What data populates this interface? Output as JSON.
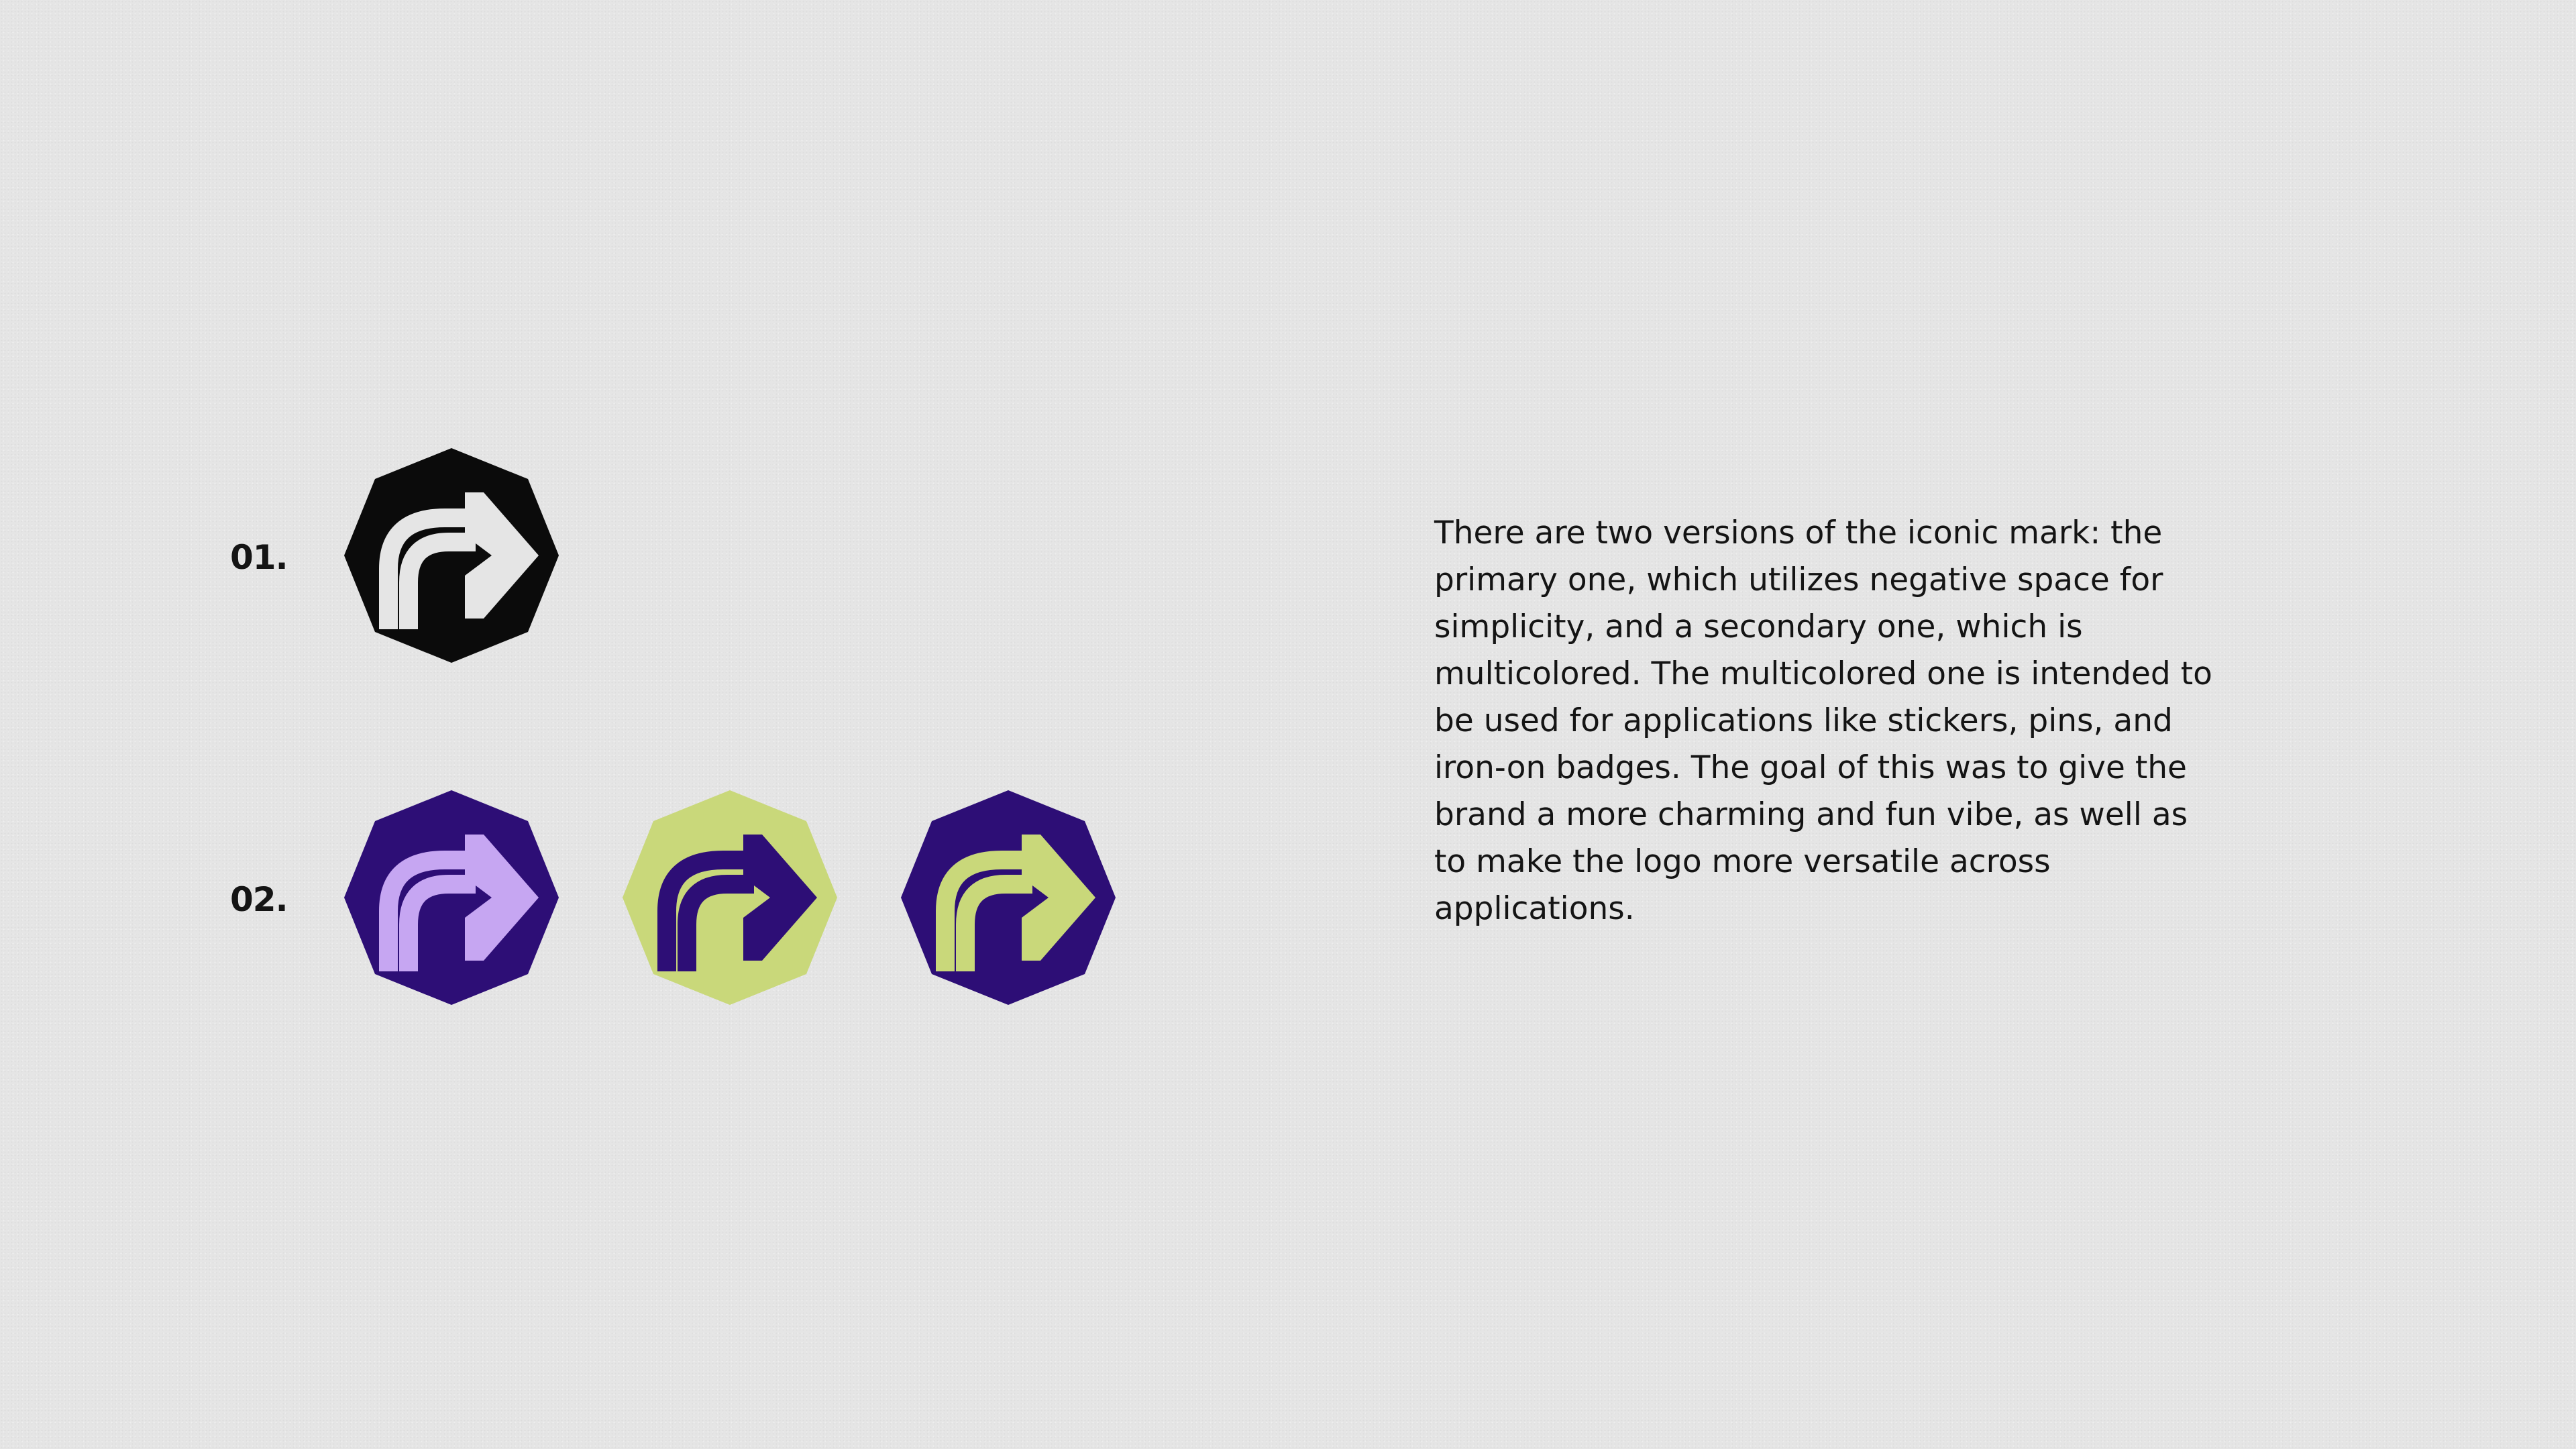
{
  "labels": {
    "primary": "01.",
    "secondary": "02."
  },
  "description": "There are two versions of the iconic mark: the primary one, which utilizes negative space for simplicity, and a secondary one, which is multicolored. The multicolored one is intended to be used for applications like stickers, pins, and iron-on badges. The goal of this was to give the brand a more charming and fun vibe, as well as to make the logo more versatile across applications.",
  "marks": [
    {
      "name": "primary-mark-black",
      "star_color": "#0b0b0b",
      "arrow_color": "#e5e5e5"
    },
    {
      "name": "secondary-mark-purple-lavender",
      "star_color": "#2d0e76",
      "arrow_color": "#c6a6f2"
    },
    {
      "name": "secondary-mark-lime-purple",
      "star_color": "#c9d87a",
      "arrow_color": "#2d0e76"
    },
    {
      "name": "secondary-mark-purple-lime",
      "star_color": "#2d0e76",
      "arrow_color": "#c9d87a"
    }
  ],
  "colors": {
    "background": "#e5e5e5",
    "text": "#141414"
  }
}
